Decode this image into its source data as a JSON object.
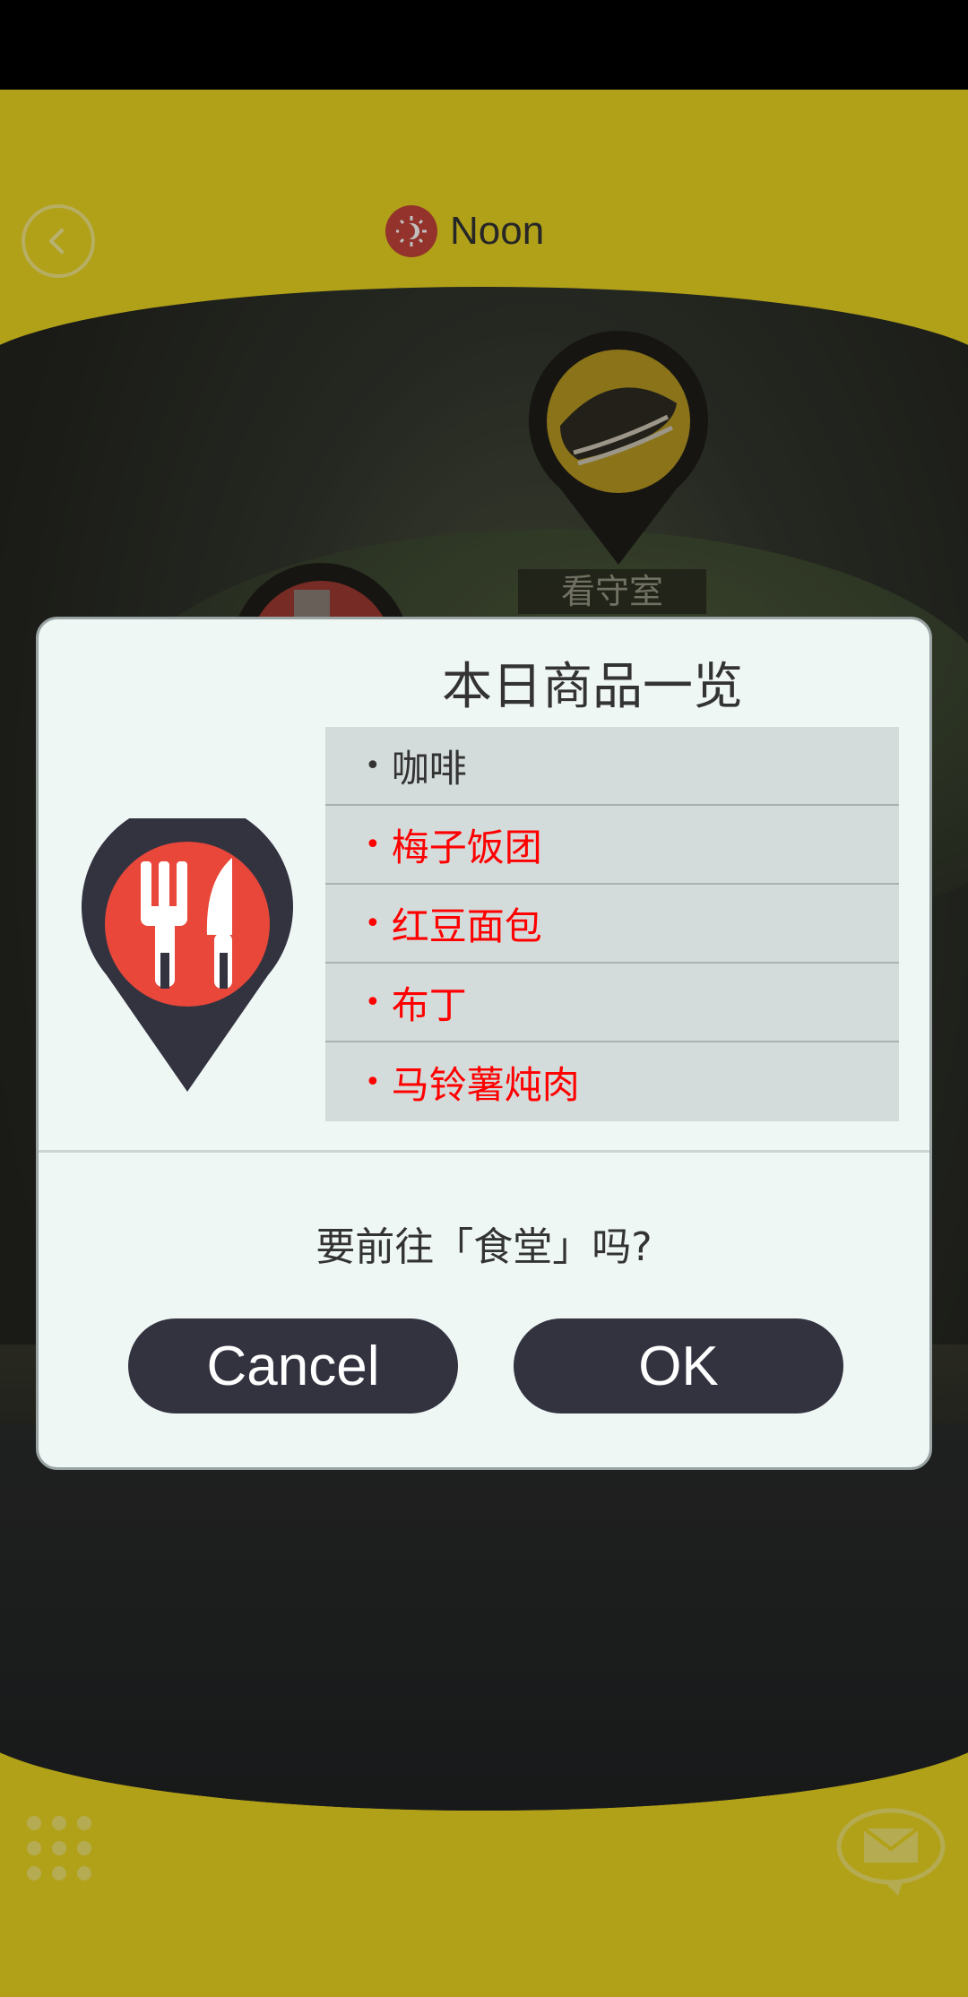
{
  "header": {
    "time_label": "Noon"
  },
  "map": {
    "guard_room_label": "看守室"
  },
  "dialog": {
    "title": "本日商品一览",
    "items": [
      {
        "label": "咖啡",
        "highlight": false
      },
      {
        "label": "梅子饭团",
        "highlight": true
      },
      {
        "label": "红豆面包",
        "highlight": true
      },
      {
        "label": "布丁",
        "highlight": true
      },
      {
        "label": "马铃薯炖肉",
        "highlight": true
      }
    ],
    "bullet": "•",
    "confirm_text": "要前往「食堂」吗?",
    "cancel_label": "Cancel",
    "ok_label": "OK"
  },
  "colors": {
    "background_yellow": "#ecd722",
    "pin_dark": "#333340",
    "pin_red": "#e8473a",
    "highlight_text": "#ff0000",
    "button_dark": "#333340"
  },
  "icons": {
    "back": "back-arrow-icon",
    "time": "sun-icon",
    "guard": "guard-cap-pin-icon",
    "canteen": "fork-knife-pin-icon",
    "menu": "grid-menu-icon",
    "mail": "mail-icon"
  }
}
